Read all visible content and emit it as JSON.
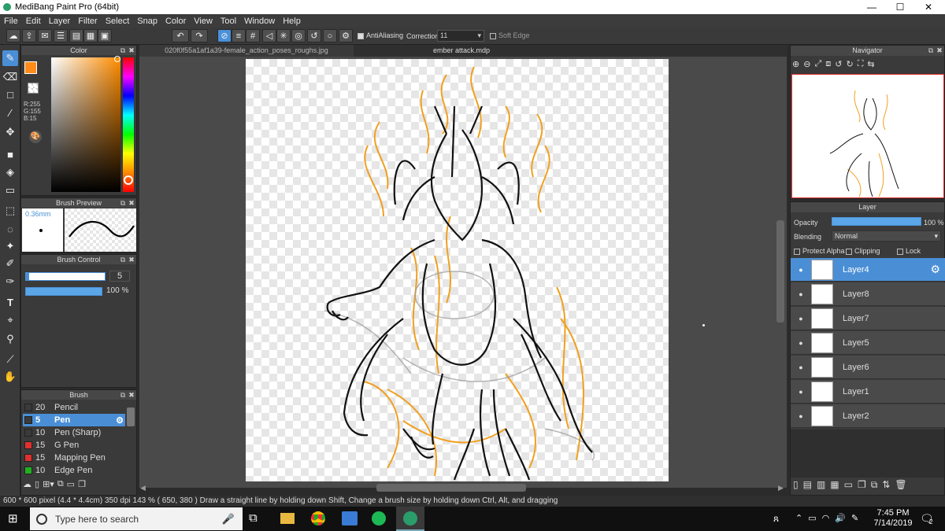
{
  "app": {
    "title": "MediBang Paint Pro (64bit)"
  },
  "window_controls": {
    "minimize": "—",
    "maximize": "☐",
    "close": "✕"
  },
  "menu": [
    "File",
    "Edit",
    "Layer",
    "Filter",
    "Select",
    "Snap",
    "Color",
    "View",
    "Tool",
    "Window",
    "Help"
  ],
  "toolbar": {
    "antialiasing_label": "AntiAliasing",
    "correction_label": "Correction",
    "correction_value": "11",
    "soft_edge_label": "Soft Edge"
  },
  "tabs": [
    {
      "label": "020f0f55a1af1a39-female_action_poses_roughs.jpg",
      "active": false
    },
    {
      "label": "ember attack.mdp",
      "active": true
    }
  ],
  "color_panel": {
    "title": "Color",
    "primary_color": "#ff8c1a",
    "r": "R:255",
    "g": "G:155",
    "b": "B:15"
  },
  "brush_preview": {
    "title": "Brush Preview",
    "size": "0.36mm"
  },
  "brush_control": {
    "title": "Brush Control",
    "size_value": "5",
    "opacity_value": "100 %"
  },
  "brush_panel": {
    "title": "Brush",
    "items": [
      {
        "size": "20",
        "name": "Pencil",
        "color": "#3a3a3a"
      },
      {
        "size": "5",
        "name": "Pen",
        "color": "#3a3a3a",
        "selected": true
      },
      {
        "size": "10",
        "name": "Pen (Sharp)",
        "color": "#3a3a3a"
      },
      {
        "size": "15",
        "name": "G Pen",
        "color": "#e03030"
      },
      {
        "size": "15",
        "name": "Mapping Pen",
        "color": "#e03030"
      },
      {
        "size": "10",
        "name": "Edge Pen",
        "color": "#20b020"
      }
    ]
  },
  "navigator": {
    "title": "Navigator"
  },
  "layer_panel": {
    "title": "Layer",
    "opacity_label": "Opacity",
    "opacity_value": "100 %",
    "opacity_fraction": 1.0,
    "blending_label": "Blending",
    "blending_value": "Normal",
    "protect_alpha": "Protect Alpha",
    "clipping": "Clipping",
    "lock": "Lock",
    "layers": [
      "Layer4",
      "Layer8",
      "Layer7",
      "Layer5",
      "Layer6",
      "Layer1",
      "Layer2"
    ],
    "selected_layer": "Layer4"
  },
  "status": {
    "text": "600 * 600 pixel  (4.4 * 4.4cm)  350 dpi  143 %  ( 650, 380 )  Draw a straight line by holding down Shift, Change a brush size by holding down Ctrl, Alt, and dragging"
  },
  "taskbar": {
    "search_placeholder": "Type here to search",
    "time": "7:45 PM",
    "date": "7/14/2019",
    "notification_count": "2"
  }
}
